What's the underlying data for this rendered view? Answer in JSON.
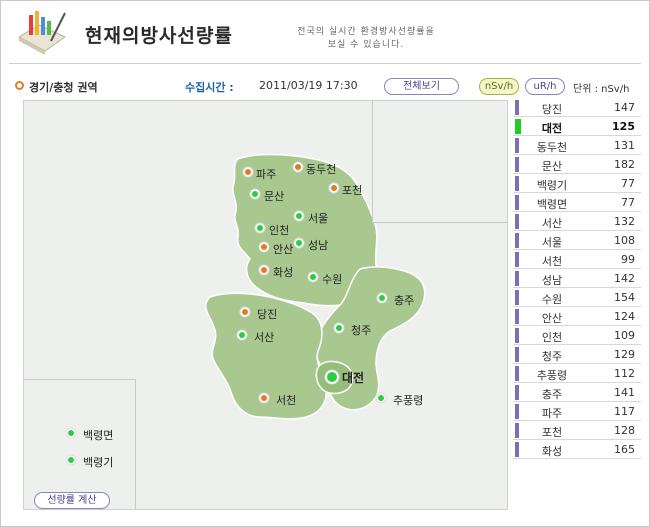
{
  "header": {
    "title": "현재의방사선량률",
    "subtitle_line1": "전국의 실시간 환경방사선량률을",
    "subtitle_line2": "보실 수 있습니다."
  },
  "toolbar": {
    "region_label": "경기/충청 권역",
    "collect_label": "수집시간 :",
    "collect_time": "2011/03/19 17:30",
    "view_all_label": "전체보기",
    "unit_nsv_label": "nSv/h",
    "unit_ur_label": "uR/h",
    "unit_text": "단위 : nSv/h"
  },
  "map": {
    "calc_button_label": "선량률 계산",
    "pins": [
      {
        "id": "paju",
        "label": "파주"
      },
      {
        "id": "dongducheon",
        "label": "동두천"
      },
      {
        "id": "munsan",
        "label": "문산"
      },
      {
        "id": "pocheon",
        "label": "포천"
      },
      {
        "id": "seoul",
        "label": "서울"
      },
      {
        "id": "incheon",
        "label": "인천"
      },
      {
        "id": "ansan",
        "label": "안산"
      },
      {
        "id": "seongnam",
        "label": "성남"
      },
      {
        "id": "hwaseong",
        "label": "화성"
      },
      {
        "id": "suwon",
        "label": "수원"
      },
      {
        "id": "chungju",
        "label": "충주"
      },
      {
        "id": "dangjin",
        "label": "당진"
      },
      {
        "id": "cheongju",
        "label": "청주"
      },
      {
        "id": "seosan",
        "label": "서산"
      },
      {
        "id": "daejeon",
        "label": "대전"
      },
      {
        "id": "seocheon",
        "label": "서천"
      },
      {
        "id": "chupungnyeong",
        "label": "추풍령"
      },
      {
        "id": "baengnyeongmyeon",
        "label": "백령면"
      },
      {
        "id": "baengnyeonggi",
        "label": "백령기"
      }
    ]
  },
  "stations": [
    {
      "name": "당진",
      "value": "147"
    },
    {
      "name": "대전",
      "value": "125"
    },
    {
      "name": "동두천",
      "value": "131"
    },
    {
      "name": "문산",
      "value": "182"
    },
    {
      "name": "백령기",
      "value": "77"
    },
    {
      "name": "백령면",
      "value": "77"
    },
    {
      "name": "서산",
      "value": "132"
    },
    {
      "name": "서울",
      "value": "108"
    },
    {
      "name": "서천",
      "value": "99"
    },
    {
      "name": "성남",
      "value": "142"
    },
    {
      "name": "수원",
      "value": "154"
    },
    {
      "name": "안산",
      "value": "124"
    },
    {
      "name": "인천",
      "value": "109"
    },
    {
      "name": "청주",
      "value": "129"
    },
    {
      "name": "추풍령",
      "value": "112"
    },
    {
      "name": "충주",
      "value": "141"
    },
    {
      "name": "파주",
      "value": "117"
    },
    {
      "name": "포천",
      "value": "128"
    },
    {
      "name": "화성",
      "value": "165"
    }
  ],
  "colors": {
    "land": "#a8c890",
    "selected_bar": "#22cc22",
    "bar": "#7e6db8",
    "pin_orange": "#e07b2c",
    "pin_green": "#2ecc40"
  }
}
